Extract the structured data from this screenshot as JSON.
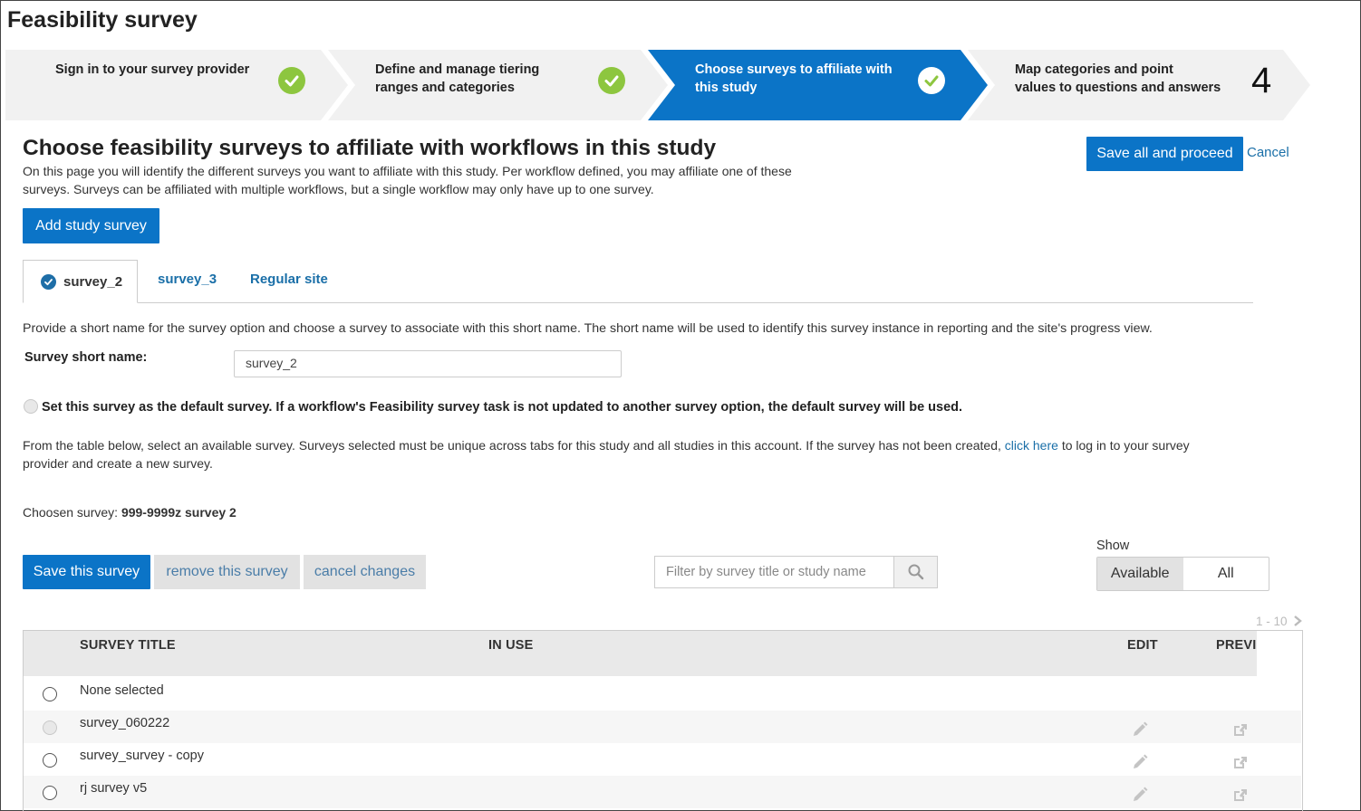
{
  "page": {
    "title": "Feasibility survey"
  },
  "stepper": [
    {
      "label_l1": "Sign in to your survey provider",
      "label_l2": "",
      "status": "done"
    },
    {
      "label_l1": "Define and manage tiering",
      "label_l2": "ranges and categories",
      "status": "done"
    },
    {
      "label_l1": "Choose surveys to affiliate with",
      "label_l2": "this study",
      "status": "active"
    },
    {
      "label_l1": "Map categories and point",
      "label_l2": "values to questions and answers",
      "number": "4"
    }
  ],
  "header": {
    "heading": "Choose feasibility surveys to affiliate with workflows in this study",
    "intro_l1": "On this page you will identify the different surveys you want to affiliate with this study. Per workflow defined, you may affiliate one of these",
    "intro_l2": "surveys. Surveys can be affiliated with multiple workflows, but a single workflow may only have up to one survey.",
    "save_all_label": "Save all and proceed",
    "cancel_label": "Cancel",
    "add_survey_label": "Add study survey"
  },
  "tabs": [
    {
      "label": "survey_2",
      "active": true
    },
    {
      "label": "survey_3"
    },
    {
      "label": "Regular site"
    }
  ],
  "form": {
    "short_name_help": "Provide a short name for the survey option and choose a survey to associate with this short name. The short name will be used to identify this survey instance in reporting and the site's progress view.",
    "short_name_label": "Survey short name:",
    "short_name_value": "survey_2",
    "default_label": "Set this survey as the default survey. If a workflow's Feasibility survey task is not updated to another survey option, the default survey will be used.",
    "table_help_pre": "From the table below, select an available survey. Surveys selected must be unique across tabs for this study and all studies in this account. If the survey has not been created,",
    "table_help_link": "click here",
    "table_help_post": "to log in to your survey",
    "table_help_l2": "provider and create a new survey.",
    "chosen_label": "Choosen survey:",
    "chosen_value": "999-9999z survey 2"
  },
  "actions": {
    "save_survey": "Save this survey",
    "remove_survey": "remove this survey",
    "cancel_changes": "cancel changes",
    "filter_placeholder": "Filter by survey title or study name"
  },
  "show": {
    "label": "Show",
    "options": [
      "Available",
      "All"
    ],
    "selected": "Available"
  },
  "pager": "1 - 10",
  "table": {
    "columns": [
      "SURVEY TITLE",
      "IN USE",
      "EDIT",
      "PREVI"
    ],
    "rows": [
      {
        "title": "None selected"
      },
      {
        "title": "survey_060222"
      },
      {
        "title": "survey_survey - copy"
      },
      {
        "title": "rj survey v5"
      }
    ]
  },
  "colors": {
    "accent": "#0b74c7",
    "check_green": "#8dc63f",
    "link": "#1a6fa8"
  }
}
